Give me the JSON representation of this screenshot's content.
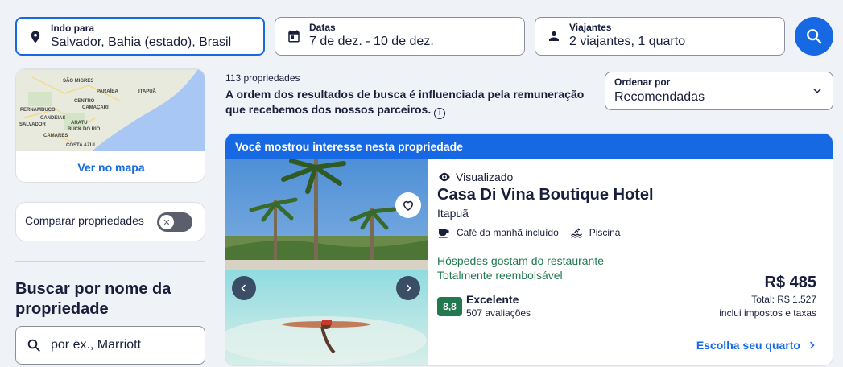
{
  "search": {
    "destination": {
      "label": "Indo para",
      "value": "Salvador, Bahia (estado), Brasil"
    },
    "dates": {
      "label": "Datas",
      "value": "7 de dez. - 10 de dez."
    },
    "travelers": {
      "label": "Viajantes",
      "value": "2 viajantes, 1 quarto"
    }
  },
  "sidebar": {
    "map_link": "Ver no mapa",
    "map_labels": [
      "SÃO MIGRES",
      "PARAÍBA",
      "ITAPUÃ",
      "CENTRO",
      "CAMAÇARI",
      "PERNAMBUCO",
      "CANDEIAS",
      "SALVADOR",
      "ARATU",
      "BUCK DO RIO",
      "CAMARES",
      "COSTA AZUL"
    ],
    "compare_label": "Comparar propriedades",
    "compare_enabled": false,
    "name_search": {
      "heading": "Buscar por nome da propriedade",
      "placeholder": "por ex., Marriott"
    }
  },
  "results": {
    "count": "113 propriedades",
    "disclaimer": "A ordem dos resultados de busca é influenciada pela remuneração que recebemos dos nossos parceiros.",
    "sort": {
      "label": "Ordenar por",
      "value": "Recomendadas"
    }
  },
  "property": {
    "banner": "Você mostrou interesse nesta propriedade",
    "viewed": "Visualizado",
    "name": "Casa Di Vina Boutique Hotel",
    "location": "Itapuã",
    "amenities": [
      "Café da manhã incluído",
      "Piscina"
    ],
    "highlights": [
      "Hóspedes gostam do restaurante",
      "Totalmente reembolsável"
    ],
    "rating": {
      "score": "8,8",
      "word": "Excelente",
      "reviews": "507 avaliações"
    },
    "price": "R$ 485",
    "total": "Total: R$ 1.527",
    "taxes": "inclui impostos e taxas",
    "cta": "Escolha seu quarto"
  },
  "colors": {
    "accent": "#1668e3",
    "positive": "#227950",
    "text": "#191e3b",
    "background": "#eff2f6"
  }
}
